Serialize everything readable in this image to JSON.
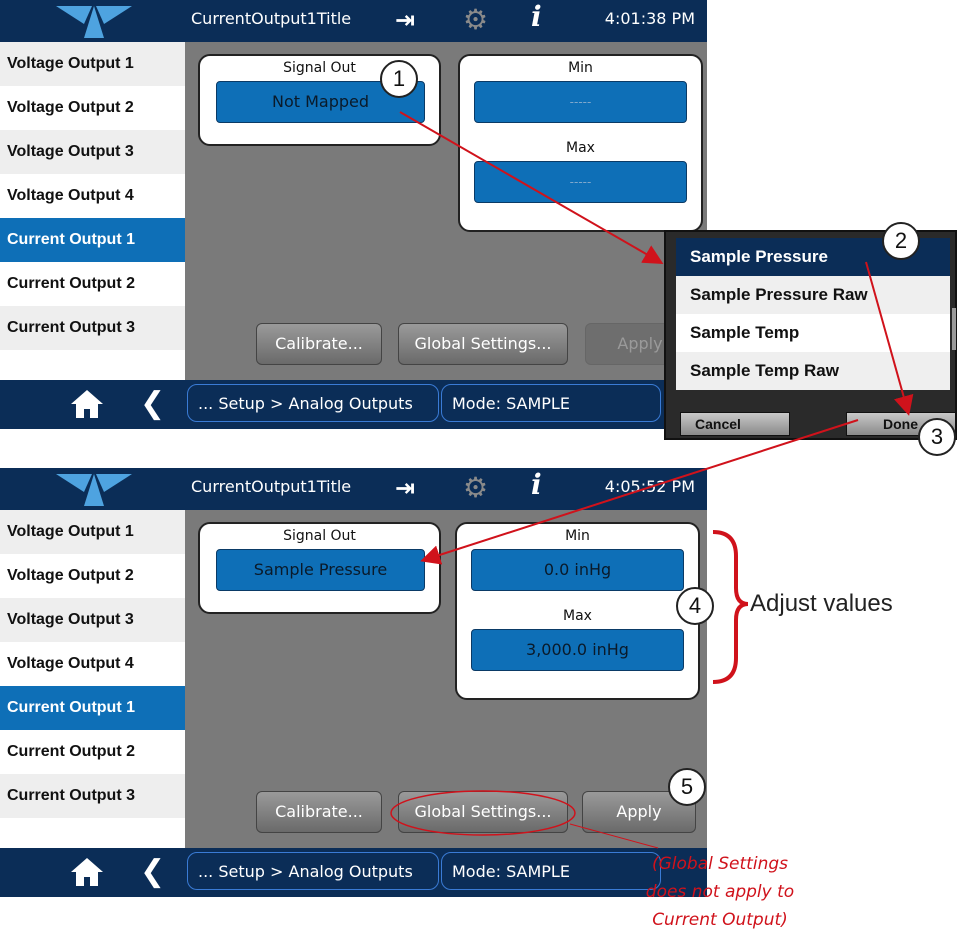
{
  "colors": {
    "accent": "#0e6fb7",
    "topbar": "#0b2d57",
    "annotation": "#d0121b"
  },
  "top_screen": {
    "title": "CurrentOutput1Title",
    "time": "4:01:38 PM",
    "sidebar": [
      "Voltage Output 1",
      "Voltage Output 2",
      "Voltage Output 3",
      "Voltage Output 4",
      "Current Output 1",
      "Current Output 2",
      "Current Output 3"
    ],
    "signal_out_label": "Signal Out",
    "signal_out_value": "Not Mapped",
    "min_label": "Min",
    "min_value": "-----",
    "max_label": "Max",
    "max_value": "-----",
    "calibrate": "Calibrate...",
    "global_settings": "Global Settings...",
    "apply": "Apply",
    "breadcrumb": "... Setup > Analog Outputs",
    "mode": "Mode: SAMPLE"
  },
  "popup": {
    "items": [
      "Sample Pressure",
      "Sample Pressure Raw",
      "Sample Temp",
      "Sample Temp Raw"
    ],
    "cancel": "Cancel",
    "done": "Done"
  },
  "bottom_screen": {
    "title": "CurrentOutput1Title",
    "time": "4:05:52 PM",
    "sidebar": [
      "Voltage Output 1",
      "Voltage Output 2",
      "Voltage Output 3",
      "Voltage Output 4",
      "Current Output 1",
      "Current Output 2",
      "Current Output 3"
    ],
    "signal_out_label": "Signal Out",
    "signal_out_value": "Sample Pressure",
    "min_label": "Min",
    "min_value": "0.0 inHg",
    "max_label": "Max",
    "max_value": "3,000.0 inHg",
    "calibrate": "Calibrate...",
    "global_settings": "Global Settings...",
    "apply": "Apply",
    "breadcrumb": "... Setup > Analog Outputs",
    "mode": "Mode: SAMPLE"
  },
  "callouts": [
    "1",
    "2",
    "3",
    "4",
    "5"
  ],
  "adjust_text": "Adjust values",
  "note": [
    "(Global Settings",
    "does not apply to",
    "Current Output)"
  ]
}
